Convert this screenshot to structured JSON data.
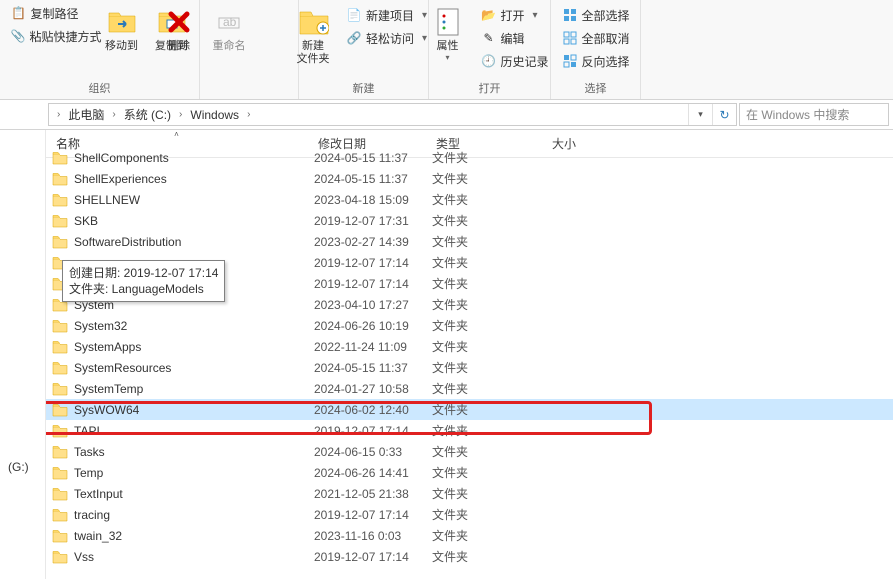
{
  "ribbon": {
    "clipboard": {
      "paste_path": "复制路径",
      "paste_shortcut": "粘贴快捷方式",
      "move_to": "移动到",
      "copy_to": "复制到",
      "delete": "删除",
      "rename": "重命名",
      "group": "组织"
    },
    "new": {
      "new_folder": "新建\n文件夹",
      "new_item": "新建项目",
      "easy_access": "轻松访问",
      "group": "新建"
    },
    "open": {
      "properties": "属性",
      "open": "打开",
      "edit": "编辑",
      "history": "历史记录",
      "group": "打开"
    },
    "select": {
      "select_all": "全部选择",
      "select_none": "全部取消",
      "invert": "反向选择",
      "group": "选择"
    }
  },
  "breadcrumb": {
    "root": "此电脑",
    "c": "系统 (C:)",
    "win": "Windows"
  },
  "search": {
    "placeholder": "在 Windows 中搜索"
  },
  "columns": {
    "name": "名称",
    "date": "修改日期",
    "type": "类型",
    "size": "大小"
  },
  "side_drive": "(G:)",
  "tooltip": {
    "line1": "创建日期: 2019-12-07 17:14",
    "line2": "文件夹: LanguageModels"
  },
  "type_folder": "文件夹",
  "rows": [
    {
      "name": "ShellComponents",
      "date": "2024-05-15 11:37",
      "partial": true
    },
    {
      "name": "ShellExperiences",
      "date": "2024-05-15 11:37"
    },
    {
      "name": "SHELLNEW",
      "date": "2023-04-18 15:09"
    },
    {
      "name": "SKB",
      "date": "2019-12-07 17:31"
    },
    {
      "name": "SoftwareDistribution",
      "date": "2023-02-27 14:39"
    },
    {
      "name": "",
      "date": "2019-12-07 17:14"
    },
    {
      "name": "",
      "date": "2019-12-07 17:14"
    },
    {
      "name": "System",
      "date": "2023-04-10 17:27"
    },
    {
      "name": "System32",
      "date": "2024-06-26 10:19"
    },
    {
      "name": "SystemApps",
      "date": "2022-11-24 11:09"
    },
    {
      "name": "SystemResources",
      "date": "2024-05-15 11:37"
    },
    {
      "name": "SystemTemp",
      "date": "2024-01-27 10:58"
    },
    {
      "name": "SysWOW64",
      "date": "2024-06-02 12:40",
      "selected": true
    },
    {
      "name": "TAPI",
      "date": "2019-12-07 17:14"
    },
    {
      "name": "Tasks",
      "date": "2024-06-15 0:33"
    },
    {
      "name": "Temp",
      "date": "2024-06-26 14:41"
    },
    {
      "name": "TextInput",
      "date": "2021-12-05 21:38"
    },
    {
      "name": "tracing",
      "date": "2019-12-07 17:14"
    },
    {
      "name": "twain_32",
      "date": "2023-11-16 0:03"
    },
    {
      "name": "Vss",
      "date": "2019-12-07 17:14"
    }
  ]
}
